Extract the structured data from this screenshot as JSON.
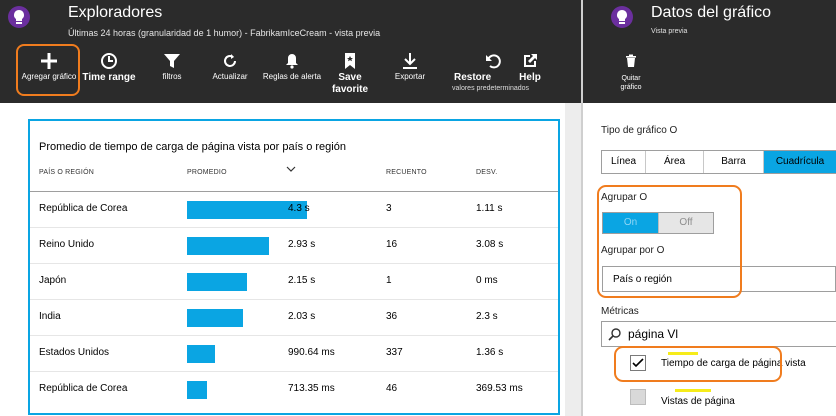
{
  "explorer": {
    "title": "Exploradores",
    "subtitle": "Últimas 24 horas (granularidad de 1 humor) - FabrikamIceCream - vista previa",
    "toolbar": {
      "add_chart": "Agregar gráfico",
      "time_range": "Time range",
      "filters": "filtros",
      "refresh": "Actualizar",
      "alert_rules": "Reglas de alerta",
      "save_favorite_1": "Save",
      "save_favorite_2": "favorite",
      "export": "Exportar",
      "restore_1": "Restore",
      "restore_2": "valores predeterminados",
      "help": "Help"
    }
  },
  "table_chart": {
    "title": "Promedio de tiempo de carga de página vista por país o región",
    "columns": {
      "country": "PAÍS O REGIÓN",
      "average": "PROMEDIO",
      "count": "RECUENTO",
      "stddev": "DESV."
    },
    "rows": [
      {
        "country": "República de Corea",
        "average": "4.3 s",
        "count": "3",
        "stddev": "1.11 s",
        "fraction": 1.0
      },
      {
        "country": "Reino Unido",
        "average": "2.93 s",
        "count": "16",
        "stddev": "3.08 s",
        "fraction": 0.68
      },
      {
        "country": "Japón",
        "average": "2.15 s",
        "count": "1",
        "stddev": "0 ms",
        "fraction": 0.5
      },
      {
        "country": "India",
        "average": "2.03 s",
        "count": "36",
        "stddev": "2.3 s",
        "fraction": 0.47
      },
      {
        "country": "Estados Unidos",
        "average": "990.64 ms",
        "count": "337",
        "stddev": "1.36 s",
        "fraction": 0.23
      },
      {
        "country": "República de Corea",
        "average": "713.35 ms",
        "count": "46",
        "stddev": "369.53 ms",
        "fraction": 0.17
      }
    ]
  },
  "chart_panel": {
    "title": "Datos del gráfico",
    "subtitle": "Vista previa",
    "remove_1": "Quitar",
    "remove_2": "gráfico",
    "chart_type_label": "Tipo de gráfico O",
    "chart_types": [
      "Línea",
      "Área",
      "Barra",
      "Cuadrícula"
    ],
    "selected_chart_type": "Cuadrícula",
    "group_label": "Agrupar O",
    "group_on": "On",
    "group_off": "Off",
    "group_by_label": "Agrupar por O",
    "group_by_value": "País o región",
    "metrics_label": "Métricas",
    "metrics_search": "página Vl",
    "metrics": [
      {
        "label": "Tiempo de carga de página vista",
        "checked": true
      },
      {
        "label": "Vistas de página",
        "checked": false
      }
    ]
  },
  "colors": {
    "accent": "#0aa5e3",
    "highlight": "#f07c1e",
    "header_bg": "#2b2b2b",
    "app_icon": "#6b2f9e"
  }
}
